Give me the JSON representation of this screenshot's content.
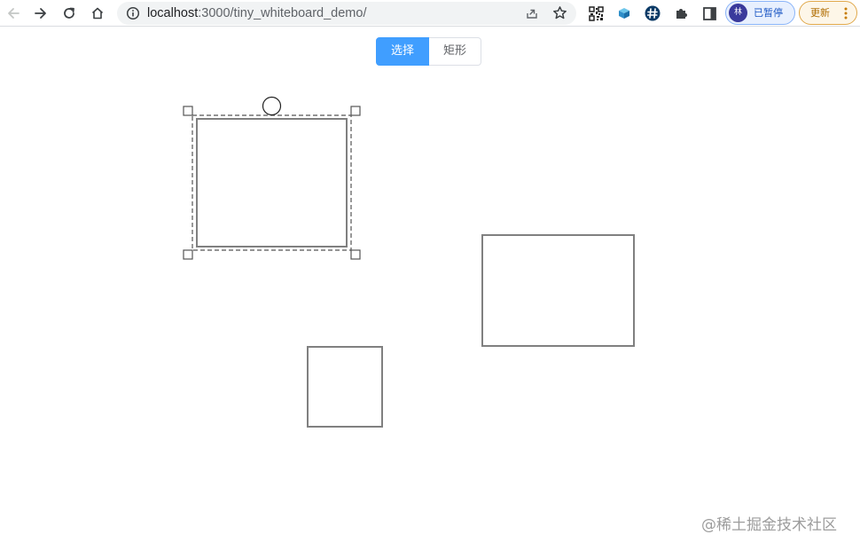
{
  "browser": {
    "url_host": "localhost",
    "url_rest": ":3000/tiny_whiteboard_demo/",
    "profile_initial": "林",
    "profile_status": "已暂停",
    "update_label": "更新"
  },
  "tools": {
    "select_label": "选择",
    "rect_label": "矩形",
    "active": "select"
  },
  "watermark": "@稀土掘金技术社区",
  "colors": {
    "accent": "#409eff",
    "shape_stroke": "#808080",
    "selection_stroke": "#555555"
  },
  "icons": {
    "back": "back-arrow-icon",
    "forward": "forward-arrow-icon",
    "reload": "reload-icon",
    "home": "home-icon",
    "info": "info-icon",
    "share": "share-icon",
    "star": "bookmark-star-icon",
    "qr": "qr-code-icon",
    "cube": "cube-extension-icon",
    "hash": "hash-extension-icon",
    "puzzle": "puzzle-extensions-icon",
    "sidepanel": "side-panel-icon"
  }
}
